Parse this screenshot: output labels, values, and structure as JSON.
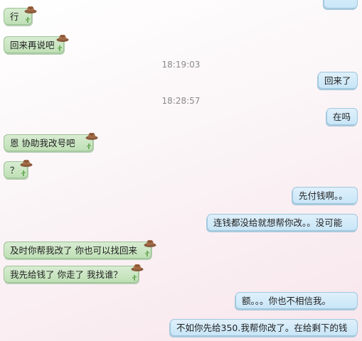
{
  "messages": [
    {
      "side": "right",
      "text": ""
    },
    {
      "side": "left",
      "text": "行"
    },
    {
      "side": "left",
      "text": "回来再说吧"
    },
    {
      "side": "time",
      "text": "18:19:03"
    },
    {
      "side": "right",
      "text": "回来了"
    },
    {
      "side": "time",
      "text": "18:28:57"
    },
    {
      "side": "right",
      "text": "在吗"
    },
    {
      "side": "left",
      "text": "恩   协助我改号吧"
    },
    {
      "side": "left",
      "text": "？"
    },
    {
      "side": "right",
      "text": "先付钱啊。。"
    },
    {
      "side": "right",
      "text": "连钱都没给就想帮你改。。没可能"
    },
    {
      "side": "left",
      "text": "及时你帮我改了  你也可以找回来"
    },
    {
      "side": "left",
      "text": "我先给钱了  你走了  我找谁？"
    },
    {
      "side": "right",
      "text": "额。。。你也不相信我。"
    },
    {
      "side": "right",
      "text": "不如你先给350.我帮你改了。在给剩下的钱"
    }
  ],
  "icons": {
    "incoming_decoration": "cowboy-hat-icon",
    "incoming_corner": "cactus-icon"
  },
  "colors": {
    "incoming_bubble": "#c9e6c0",
    "outgoing_bubble": "#d4ebf9",
    "timestamp": "#8a8a8a"
  }
}
